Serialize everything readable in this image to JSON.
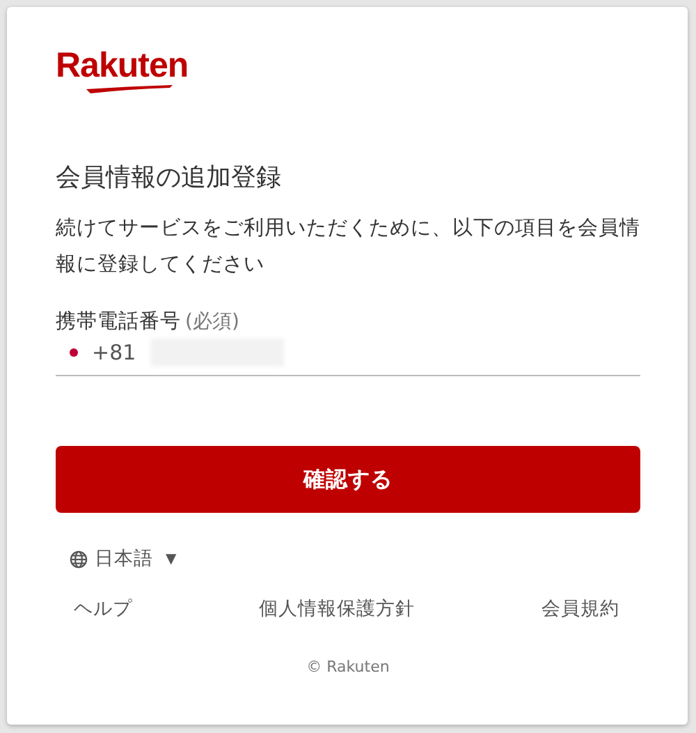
{
  "logo": {
    "text": "Rakuten"
  },
  "title": "会員情報の追加登録",
  "description": "続けてサービスをご利用いただくために、以下の項目を会員情報に登録してください",
  "phone_field": {
    "label": "携帯電話番号",
    "required_note": "(必須)",
    "country_code": "+81",
    "number_blurred": true
  },
  "submit_button": "確認する",
  "language": {
    "label": "日本語",
    "caret": "▼"
  },
  "footer_links": [
    "ヘルプ",
    "個人情報保護方針",
    "会員規約"
  ],
  "copyright": "© Rakuten"
}
